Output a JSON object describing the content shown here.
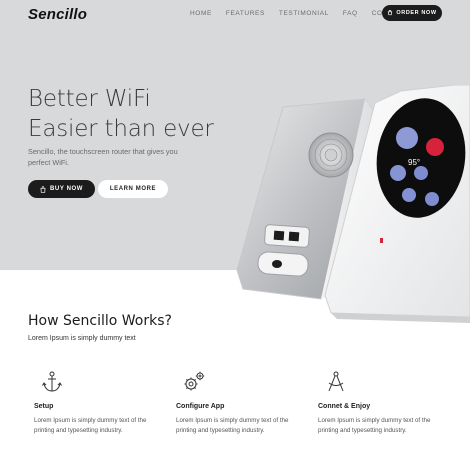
{
  "header": {
    "logo": "Sencillo",
    "nav": [
      "HOME",
      "FEATURES",
      "TESTIMONIAL",
      "FAQ",
      "CONTACT"
    ],
    "order_button": "ORDER NOW"
  },
  "hero": {
    "title_line1": "Better WiFi",
    "title_line2": "Easier than ever",
    "subtitle": "Sencillo, the touchscreen router that gives you perfect WiFi.",
    "buy_button": "BUY NOW",
    "learn_button": "LEARN MORE",
    "device_temperature": "95°"
  },
  "how": {
    "title": "How Sencillo Works?",
    "subtitle": "Lorem Ipsum is simply dummy text",
    "features": [
      {
        "title": "Setup",
        "icon": "anchor-icon",
        "text": "Lorem Ipsum is simply dummy text of the printing and typesetting industry."
      },
      {
        "title": "Configure App",
        "icon": "gears-icon",
        "text": "Lorem Ipsum is simply dummy text of the printing and typesetting industry."
      },
      {
        "title": "Connet & Enjoy",
        "icon": "compass-icon",
        "text": "Lorem Ipsum is simply dummy text of the printing and typesetting industry."
      }
    ]
  },
  "colors": {
    "hero_bg": "#d8d9db",
    "dark_button": "#1c1c1c",
    "accent_red": "#d6223a",
    "accent_blue": "#7f8dd0"
  }
}
